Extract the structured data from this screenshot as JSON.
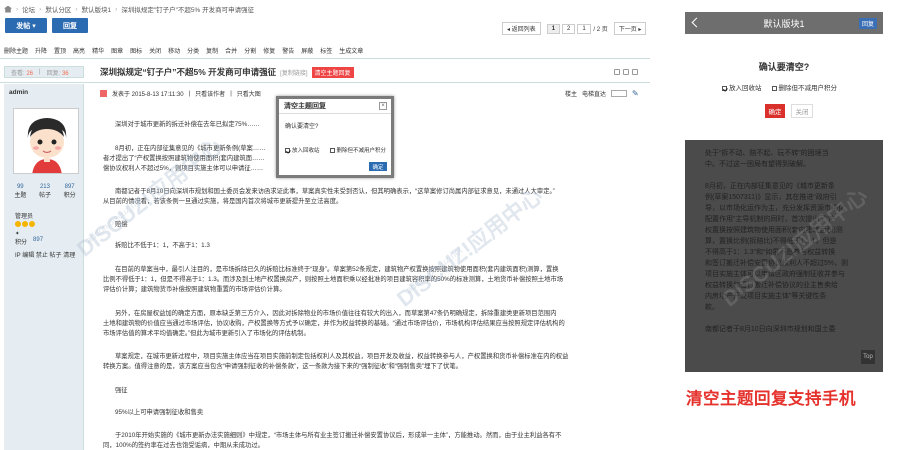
{
  "breadcrumb": [
    "论坛",
    "默认分区",
    "默认版块1",
    "深圳拟规定\"钉子户\"不超5% 开发商可申请强征"
  ],
  "buttons": {
    "post": "发帖",
    "reply": "回复"
  },
  "pager": {
    "prev": "◂ 返回列表",
    "p1": "1",
    "p2": "2",
    "input": "1",
    "total": "/ 2 页",
    "next": "下一页 ▸"
  },
  "toolbar": [
    "删除主题",
    "升降",
    "置顶",
    "高亮",
    "精华",
    "图章",
    "图标",
    "关闭",
    "移动",
    "分类",
    "复制",
    "合并",
    "分割",
    "修复",
    "警告",
    "屏蔽",
    "标签",
    "生成文章"
  ],
  "stats": {
    "views_label": "查看:",
    "views": "26",
    "replies_label": "回复:",
    "replies": "36"
  },
  "thread": {
    "title": "深圳拟规定“钉子户”不超5% 开发商可申请强征",
    "type": "[复制链接]",
    "tag": "清空主题回复"
  },
  "author": {
    "name": "admin",
    "s1": "99",
    "s1_label": "主题",
    "s2": "213",
    "s2_label": "帖子",
    "s3": "897",
    "s3_label": "积分",
    "role": "管理员",
    "pts_label": "积分",
    "pts": "897",
    "ip": "IP 编辑 禁止 帖子 清理"
  },
  "post": {
    "date": "发表于 2015-8-13 17:11:30",
    "a1": "只看该作者",
    "a2": "只看大图",
    "r1": "楼主",
    "r2": "电梯直达"
  },
  "paragraphs": [
    "深圳对于城市更新的拆迁补偿在去年已拟定75%……",
    "8月初，正在内部征集意见的《城市更新条例(草案……",
    "者才提出了“产权置换按照建筑物使用面积(套内建筑面……",
    "偿协议权利人不超过5%，则项目实施主体可以申请征……",
    "南都记者于8月10日向深圳市规划和国土委员会发来访函求证此事，草案真实性未受到否认，但其明确表示，“这草案修订尚属内部征求意见，未通过人大审定。”",
    "从目前的情况看，若该条例一旦通过实施，将是国内首次将城市更新提升至立法高度。",
    "赔偿",
    "拆赔比不低于1：1，不高于1：1.3",
    "在目前的草案当中，最引人注目的，是市场拆除已久的拆赔比标准终于“现身”。草案第52条规定，建筑物产权置换按照建筑物使用面积(套内建筑面积)测算，置换",
    "比例不得低于1：1，但是不得高于1：1.3。而涉及到土地产权置换房产，则按照土地面积乘以经批准的项目建筑容积率的50%的标准测算，土地货币补偿按照土地市场",
    "评估价计算；建筑物货币补偿按照建筑物重置的市场评估价计算。",
    "另外，在房屋权益加的确定方面，原本缺乏第三方介入，因此对拆除物业的市场价值往往有较大的出入，而草案第47条仍明确规定，拆除重建类更新项目范围内",
    "土地和建筑物的价值应当通过市场评估，协议收购，产权置换等方式予以确定，并作为权益转换的基础。“通过市场评估价，市场机构评估结果应当按照规定评估机构的",
    "市场评估值的算术平均值确定。”但此为城市更新引入了市场化的评估机制。",
    "草案规定，在城市更新过程中，项目实施主体应当在项目实施前制定包括权利人及其权益，项目开发及收益，权益转换参与人，产权置换和货币补偿标准在内的权益",
    "转换方案。值得注意的是，该方案应当包含“申请强制征收的补偿条款”，这一条款为接下来的“强制征收”和“强制售卖”埋下了伏笔。",
    "强征",
    "95%以上可申请强制征收和售卖",
    "于2010年开始实施的《城市更新办法实施细则》中规定，“市场主体与所有业主签订搬迁补偿安置协议后，形成单一主体”，方能推动。然而，由于业主利益各有不",
    "同，100%的签约率在过去也饱受诟病，中期从未成功过。"
  ],
  "modal": {
    "title": "清空主题回复",
    "question": "确认要清空?",
    "opt1": "放入回收站",
    "opt2": "删除但不减用户积分",
    "ok": "确定",
    "close": "×"
  },
  "mobile": {
    "header": "默认版块1",
    "reply": "回复",
    "question": "确认要清空?",
    "opt1": "放入回收站",
    "opt2": "删除但不减用户积分",
    "ok": "确定",
    "cancel": "关闭",
    "lines": [
      "处于“拆不动、赔不起、玩不转”的困境当",
      "中。不过这一困局有望得到破解。",
      "",
      "8月初，正在内部征集意见的《城市更新条",
      "例(草案1507311)》显示，其在推进“政府引",
      "导，以市场化运作为主，充分发挥资源市场化",
      "配置作用”主导机制的同时，首次提出了“产",
      "权置换按照建筑物使用面积(套内建筑面积)测",
      "算，置换比例(拆赔比)不得低于1：1，但是",
      "不得高于1：1.3”和“如果不愿参与权益转换",
      "和签订搬迁补偿安置协议权利人不超过5%，则",
      "项目实施主体可以申请区政府强制征收并参与",
      "权益转换和签订搬迁补偿协议的业主售卖给",
      "内房地产开发项目实施主体”等关键性条",
      "款。",
      "",
      "南都记者于8月10日向深圳市规划和国土委"
    ],
    "top": "Top"
  },
  "caption": "清空主题回复支持手机",
  "watermark": {
    "brand": "DISCUZ!应用中心",
    "url": "addon.discuz.net"
  }
}
